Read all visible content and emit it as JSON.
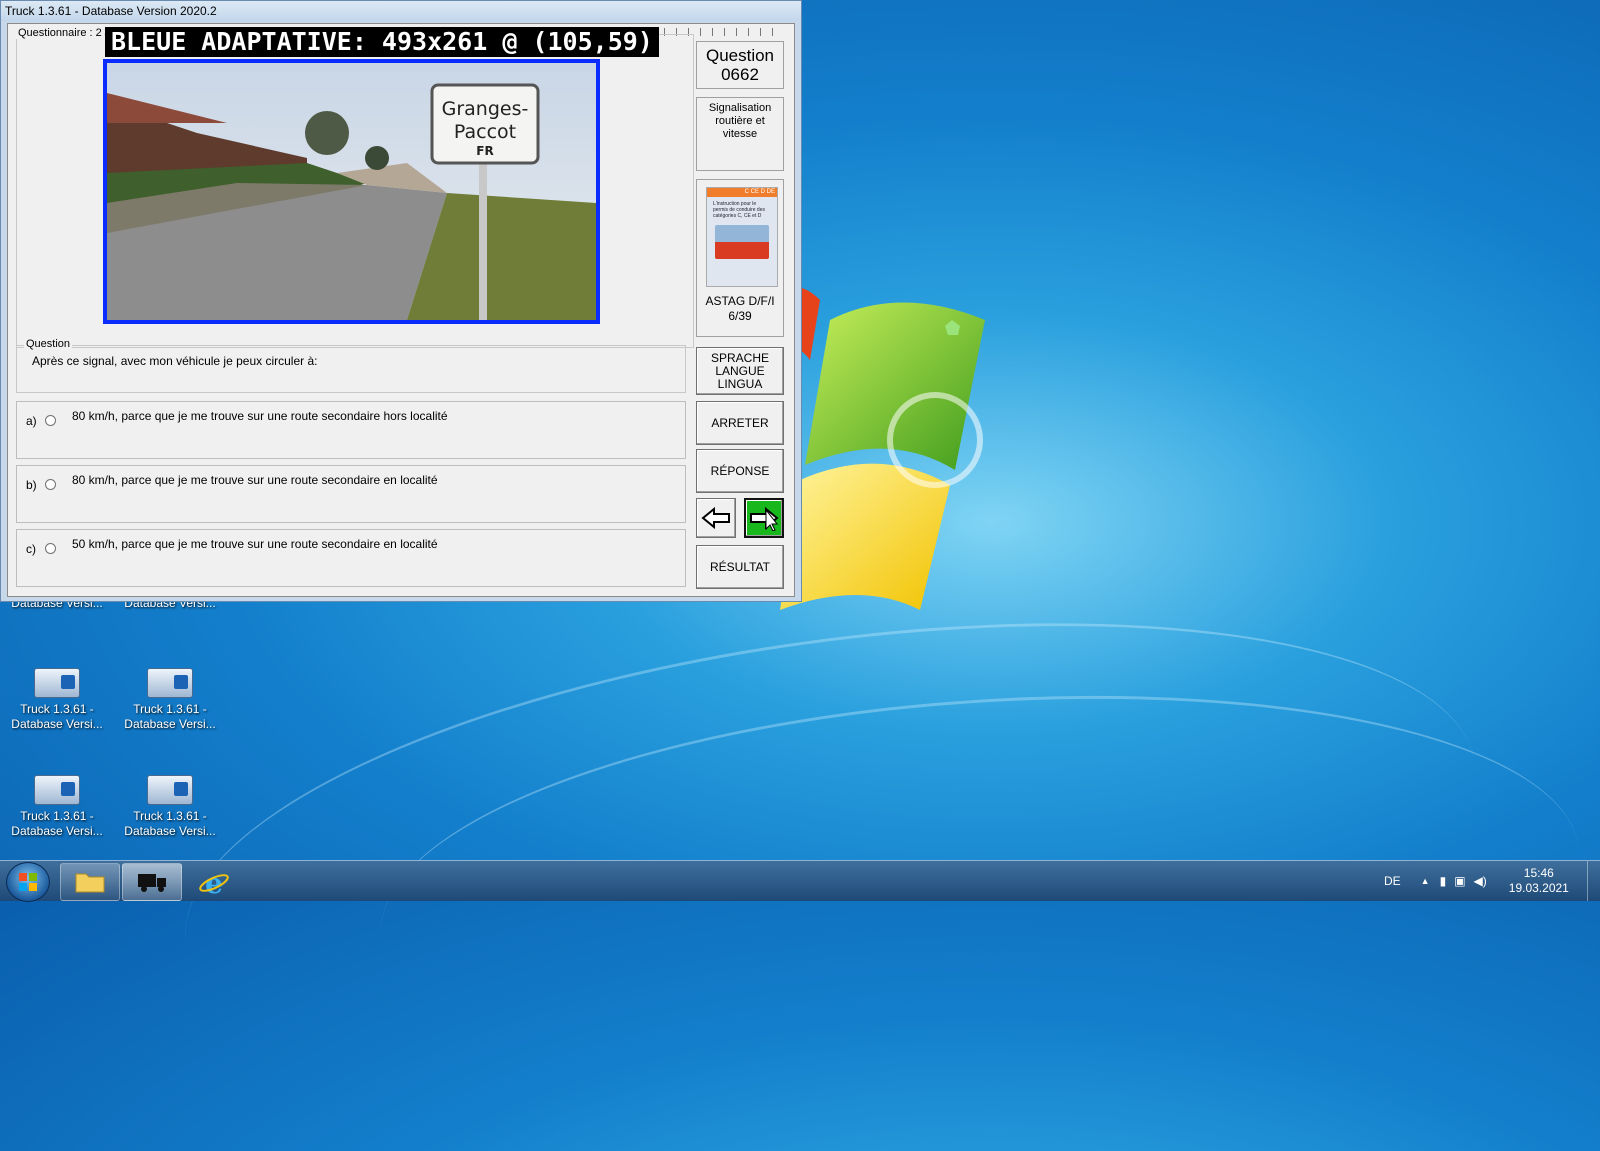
{
  "window": {
    "title": "Truck 1.3.61 - Database Version 2020.2"
  },
  "questionnaire": {
    "label": "Questionnaire : 2"
  },
  "overlay_label": "BLEUE ADAPTATIVE: 493x261 @ (105,59)",
  "photo": {
    "sign_line1": "Granges-",
    "sign_line2": "Paccot",
    "sign_line3": "FR"
  },
  "question": {
    "label_top": "Question",
    "number": "0662",
    "category": "Signalisation routière et vitesse",
    "book_source": "ASTAG D/F/I",
    "book_page": "6/39",
    "group_label": "Question",
    "text": "Après ce signal, avec mon véhicule je peux circuler à:"
  },
  "answers": [
    {
      "letter": "a)",
      "text": "80 km/h, parce que je me trouve sur une route secondaire hors localité"
    },
    {
      "letter": "b)",
      "text": "80 km/h, parce que je me trouve sur une route secondaire en localité"
    },
    {
      "letter": "c)",
      "text": "50 km/h, parce que je me trouve sur une route secondaire en localité"
    }
  ],
  "buttons": {
    "language_line1": "SPRACHE",
    "language_line2": "LANGUE",
    "language_line3": "LINGUA",
    "stop": "ARRETER",
    "answer": "RÉPONSE",
    "result": "RÉSULTAT"
  },
  "book_cover": {
    "badges": "C CE D DE",
    "title": "L'instruction pour le permis de conduire des catégories C, CE et D"
  },
  "desktop_icons": [
    {
      "line1": "",
      "line2": "Database Versi..."
    },
    {
      "line1": "",
      "line2": "Database Versi..."
    },
    {
      "line1": "Truck 1.3.61 -",
      "line2": "Database Versi..."
    },
    {
      "line1": "Truck 1.3.61 -",
      "line2": "Database Versi..."
    },
    {
      "line1": "Truck 1.3.61 -",
      "line2": "Database Versi..."
    },
    {
      "line1": "Truck 1.3.61 -",
      "line2": "Database Versi..."
    }
  ],
  "taskbar": {
    "language": "DE",
    "time": "15:46",
    "date": "19.03.2021"
  },
  "colors": {
    "next_button": "#18b81d",
    "highlight_frame": "#0a2cff"
  },
  "icons": [
    "start-orb-icon",
    "folder-icon",
    "truck-icon",
    "internet-explorer-icon",
    "arrow-left-icon",
    "arrow-right-icon",
    "mouse-cursor-icon"
  ]
}
